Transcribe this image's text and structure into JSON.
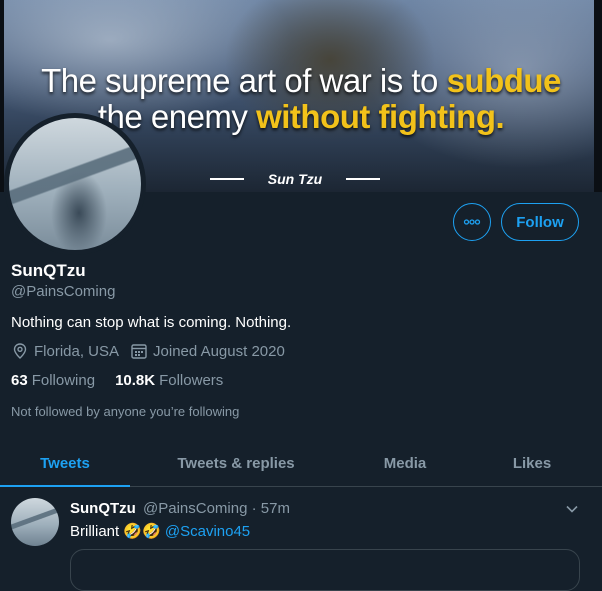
{
  "banner": {
    "quote_line1_plain": "The supreme art of war is to ",
    "quote_line1_highlight": "subdue",
    "quote_line2_plain": "the enemy ",
    "quote_line2_highlight": "without fighting.",
    "author": "Sun Tzu",
    "highlight_color": "#f2c21a"
  },
  "profile": {
    "name": "SunQTzu",
    "handle": "@PainsComing",
    "bio": "Nothing can stop what is coming. Nothing.",
    "location": "Florida, USA",
    "joined": "Joined August 2020",
    "following_count": "63",
    "following_label": "Following",
    "followers_count": "10.8K",
    "followers_label": "Followers",
    "followed_note": "Not followed by anyone you’re following"
  },
  "actions": {
    "more_icon": "more-icon",
    "follow_label": "Follow"
  },
  "tabs": [
    {
      "label": "Tweets",
      "active": true
    },
    {
      "label": "Tweets & replies",
      "active": false
    },
    {
      "label": "Media",
      "active": false
    },
    {
      "label": "Likes",
      "active": false
    }
  ],
  "tweet": {
    "name": "SunQTzu",
    "handle": "@PainsComing",
    "separator": "·",
    "time": "57m",
    "text": "Brilliant 🤣🤣",
    "mention": "@Scavino45"
  },
  "colors": {
    "background": "#15202b",
    "accent": "#1da1f2",
    "secondary_text": "#8899a6",
    "border": "#38444d"
  }
}
